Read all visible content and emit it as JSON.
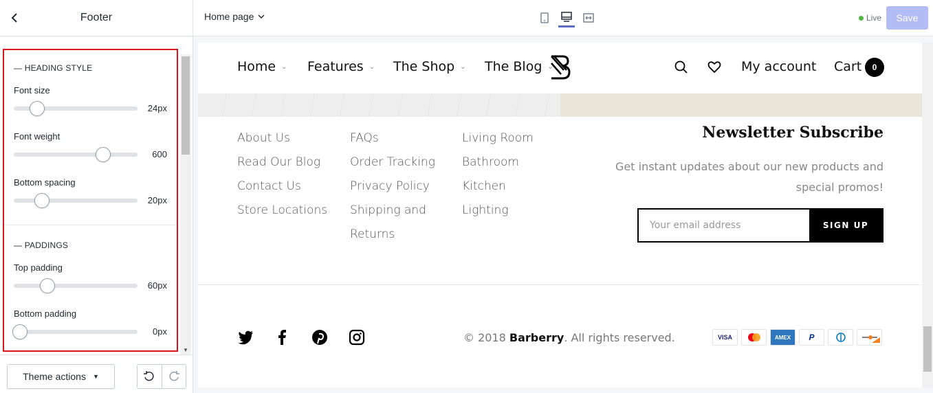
{
  "header": {
    "back_label": "Back",
    "panel_title": "Footer",
    "page_select": "Home page",
    "live_label": "Live",
    "save_label": "Save",
    "view_modes": [
      "mobile",
      "desktop",
      "fullscreen"
    ]
  },
  "settings": {
    "heading_style": {
      "title": "— HEADING STYLE",
      "fields": [
        {
          "label": "Font size",
          "value": "24px",
          "position": 0.19
        },
        {
          "label": "Font weight",
          "value": "600",
          "position": 0.72
        },
        {
          "label": "Bottom spacing",
          "value": "20px",
          "position": 0.23
        }
      ]
    },
    "paddings": {
      "title": "— PADDINGS",
      "fields": [
        {
          "label": "Top padding",
          "value": "60px",
          "position": 0.27
        },
        {
          "label": "Bottom padding",
          "value": "0px",
          "position": 0.05
        }
      ]
    }
  },
  "bottom": {
    "theme_actions": "Theme actions"
  },
  "preview": {
    "nav": {
      "items": [
        "Home",
        "Features",
        "The Shop",
        "The Blog"
      ],
      "my_account": "My account",
      "cart": "Cart",
      "cart_count": "0"
    },
    "footer_links": {
      "col1": [
        "About Us",
        "Read Our Blog",
        "Contact Us",
        "Store Locations"
      ],
      "col2": [
        "FAQs",
        "Order Tracking",
        "Privacy Policy",
        "Shipping and",
        "Returns"
      ],
      "col3": [
        "Living Room",
        "Bathroom",
        "Kitchen",
        "Lighting"
      ]
    },
    "newsletter": {
      "title": "Newsletter Subscribe",
      "description": "Get instant updates about our new products and special promos!",
      "placeholder": "Your email address",
      "button": "SIGN UP"
    },
    "copyright_prefix": "© 2018 ",
    "copyright_brand": "Barberry",
    "copyright_suffix": ". All rights reserved.",
    "payments": [
      "VISA",
      "MC",
      "AMEX",
      "PayPal",
      "Diners",
      "Discover"
    ]
  },
  "colors": {
    "accent": "#5c6ac4",
    "save_disabled": "#b3bcf5",
    "highlight_border": "#d8141c",
    "live_dot": "#50b83c"
  }
}
